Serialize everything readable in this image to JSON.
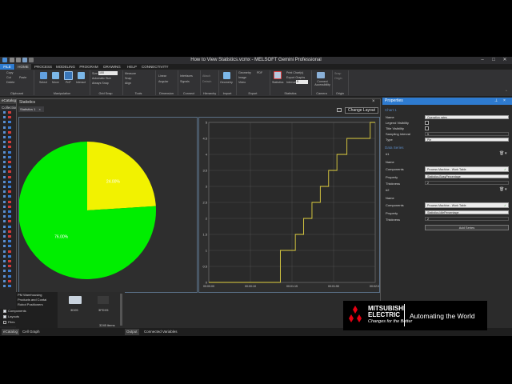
{
  "window": {
    "title": "How to View Statistics.vcmx - MELSOFT Gemini Professional"
  },
  "menu": [
    "FILE",
    "HOME",
    "PROCESS",
    "MODELING",
    "PROGRAM",
    "DRAWING",
    "HELP",
    "CONNECTIVITY"
  ],
  "ribbon": {
    "clipboard": {
      "label": "Clipboard",
      "items": [
        "Copy",
        "Cut",
        "Delete",
        "Paste"
      ]
    },
    "manipulation": {
      "label": "Manipulation",
      "items": [
        "Select",
        "Move",
        "PnP",
        "Interact"
      ]
    },
    "gridsnap": {
      "label": "Grid Snap",
      "items": [
        "Size",
        "Automatic Size",
        "Always Snap"
      ],
      "size_value": "100"
    },
    "tools": {
      "label": "Tools",
      "items": [
        "Measure",
        "Snap",
        "Align"
      ]
    },
    "dimension": {
      "label": "Dimension",
      "items": [
        "Linear",
        "Angular"
      ]
    },
    "connect": {
      "label": "Connect",
      "items": [
        "Interfaces",
        "Signals"
      ]
    },
    "hierarchy": {
      "label": "Hierarchy",
      "items": [
        "Attach",
        "Detach"
      ]
    },
    "import": {
      "label": "Import",
      "items": [
        "Geometry"
      ]
    },
    "export": {
      "label": "Export",
      "items": [
        "Geometry",
        "Image",
        "Video",
        "PDF"
      ]
    },
    "statistics": {
      "label": "Statistics",
      "items": [
        "Statistics",
        "Print Chart(s)",
        "Export Graphs",
        "Interval"
      ],
      "interval_value": "5"
    },
    "camera": {
      "label": "Camera",
      "items": [
        "Connect Accessibility"
      ]
    },
    "origin": {
      "label": "Origin",
      "items": [
        "Snap",
        "Origin"
      ]
    }
  },
  "left_panel": {
    "tab": "eCatalog",
    "second_tab": "Collections",
    "list_items": [
      "PM Warehousing",
      "Products and Contai",
      "Robot Positioners"
    ],
    "checkboxes": [
      {
        "label": "Components",
        "checked": true
      },
      {
        "label": "Layouts",
        "checked": true
      },
      {
        "label": "Files",
        "checked": false
      }
    ],
    "catalog_items": [
      "3D05",
      "3FDX5"
    ],
    "items_count": "3245 items"
  },
  "stats_window": {
    "title": "Statistics",
    "tab": "Statistics 1",
    "change_layout": "Change Layout"
  },
  "pie": {
    "slices": [
      {
        "label": "76.00%",
        "value": 76.0,
        "color": "#00ee00"
      },
      {
        "label": "24.00%",
        "value": 24.0,
        "color": "#f2f200"
      }
    ]
  },
  "chart_data": {
    "type": "line",
    "title": "",
    "xlabel": "",
    "ylabel": "",
    "x_ticks": [
      "00:00:00",
      "00:00:10",
      "00:01:15",
      "00:01:50",
      "00:02:00"
    ],
    "y_ticks": [
      "0",
      "0.5",
      "1",
      "1.5",
      "2",
      "2.5",
      "3",
      "3.5",
      "4",
      "4.5",
      "5"
    ],
    "ylim": [
      0,
      5
    ],
    "series": [
      {
        "color": "#e0d040",
        "x": [
          0,
          0.43,
          0.43,
          0.52,
          0.52,
          0.57,
          0.57,
          0.62,
          0.62,
          0.67,
          0.67,
          0.72,
          0.72,
          0.77,
          0.77,
          0.83,
          0.83,
          0.97,
          0.97,
          1.0
        ],
        "values": [
          0,
          0,
          1,
          1,
          1.5,
          1.5,
          2,
          2,
          2.5,
          2.5,
          3,
          3,
          3.5,
          3.5,
          4,
          4,
          4.5,
          4.5,
          5,
          5
        ]
      }
    ]
  },
  "properties": {
    "header": "Properties",
    "section_chart": "Chart 1",
    "name_label": "Name",
    "name_value": "Operation rates",
    "legend_label": "Legend Visibility",
    "title_label": "Title Visibility",
    "sampling_label": "Sampling Interval",
    "sampling_value": "5",
    "type_label": "Type",
    "type_value": "Pie",
    "section_series": "Data Series",
    "series": [
      {
        "id": "#1",
        "name_label": "Name",
        "components_label": "Components",
        "components_value": "Process Machine - Work Table",
        "property_label": "Property",
        "property_value": "Statistics.BusyPercentage",
        "thickness_label": "Thickness",
        "thickness_value": "2"
      },
      {
        "id": "#2",
        "name_label": "Name",
        "components_label": "Components",
        "components_value": "Process Machine - Work Table",
        "property_label": "Property",
        "property_value": "Statistics.IdlePercentage",
        "thickness_label": "Thickness",
        "thickness_value": "2"
      }
    ],
    "add_series": "Add Series"
  },
  "bottom_tabs": [
    "eCatalog",
    "Cell Graph",
    "Output",
    "Connected Variables"
  ],
  "logo": {
    "brand_line1": "MITSUBISHI",
    "brand_line2": "ELECTRIC",
    "slogan": "Changes for the Better",
    "tagline": "Automating the World"
  }
}
